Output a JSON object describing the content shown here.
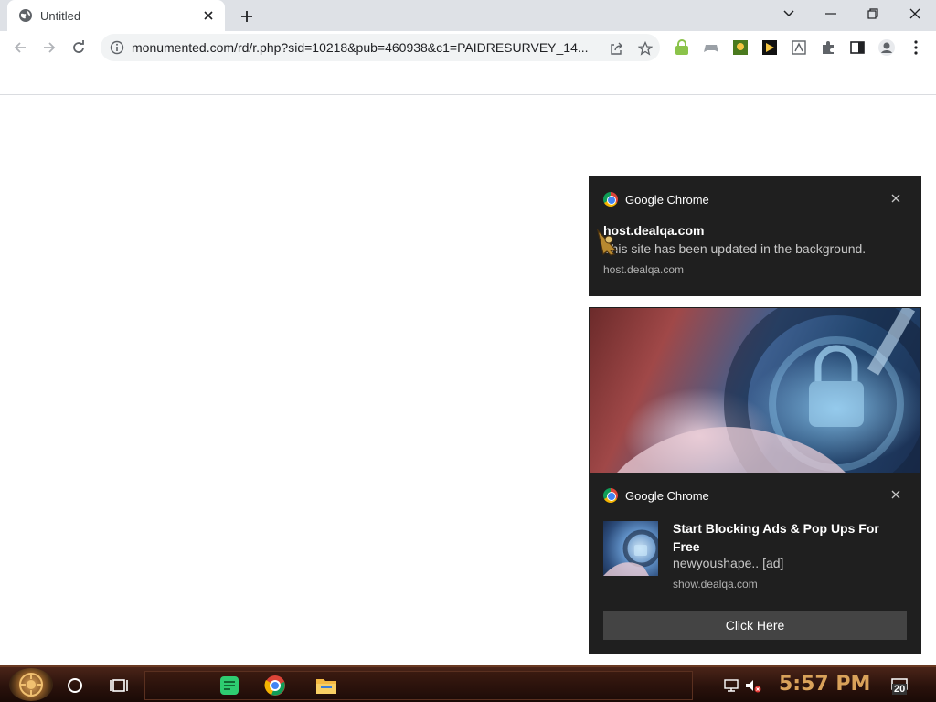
{
  "browser": {
    "tab": {
      "title": "Untitled"
    },
    "url": "monumented.com/rd/r.php?sid=10218&pub=460938&c1=PAIDRESURVEY_14..."
  },
  "notifications": [
    {
      "app": "Google Chrome",
      "title": "host.dealqa.com",
      "body": "This site has been updated in the background.",
      "source": "host.dealqa.com"
    },
    {
      "app": "Google Chrome",
      "title": "Start Blocking Ads & Pop Ups For Free",
      "body": "newyoushape.. [ad]",
      "source": "show.dealqa.com",
      "button_label": "Click Here"
    }
  ],
  "taskbar": {
    "clock": "5:57 PM",
    "notification_count": "20"
  }
}
